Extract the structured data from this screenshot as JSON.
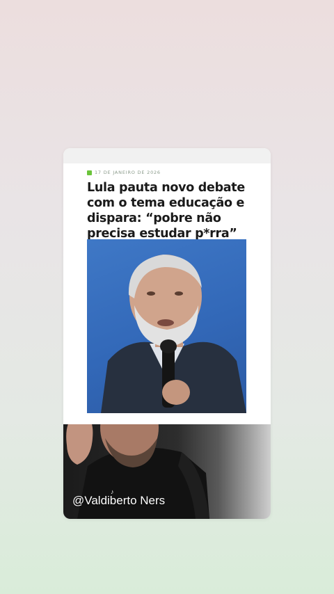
{
  "article": {
    "date": "17 DE JANEIRO DE 2026",
    "headline": "Lula pauta novo debate com o tema educação e dispara: “pobre não precisa estudar p*rra”"
  },
  "overlay": {
    "handle": "@Valdiberto Ners",
    "icon": "tiktok-icon"
  },
  "colors": {
    "date_marker": "#6bc43b",
    "photo_background": "#3f78c6"
  }
}
